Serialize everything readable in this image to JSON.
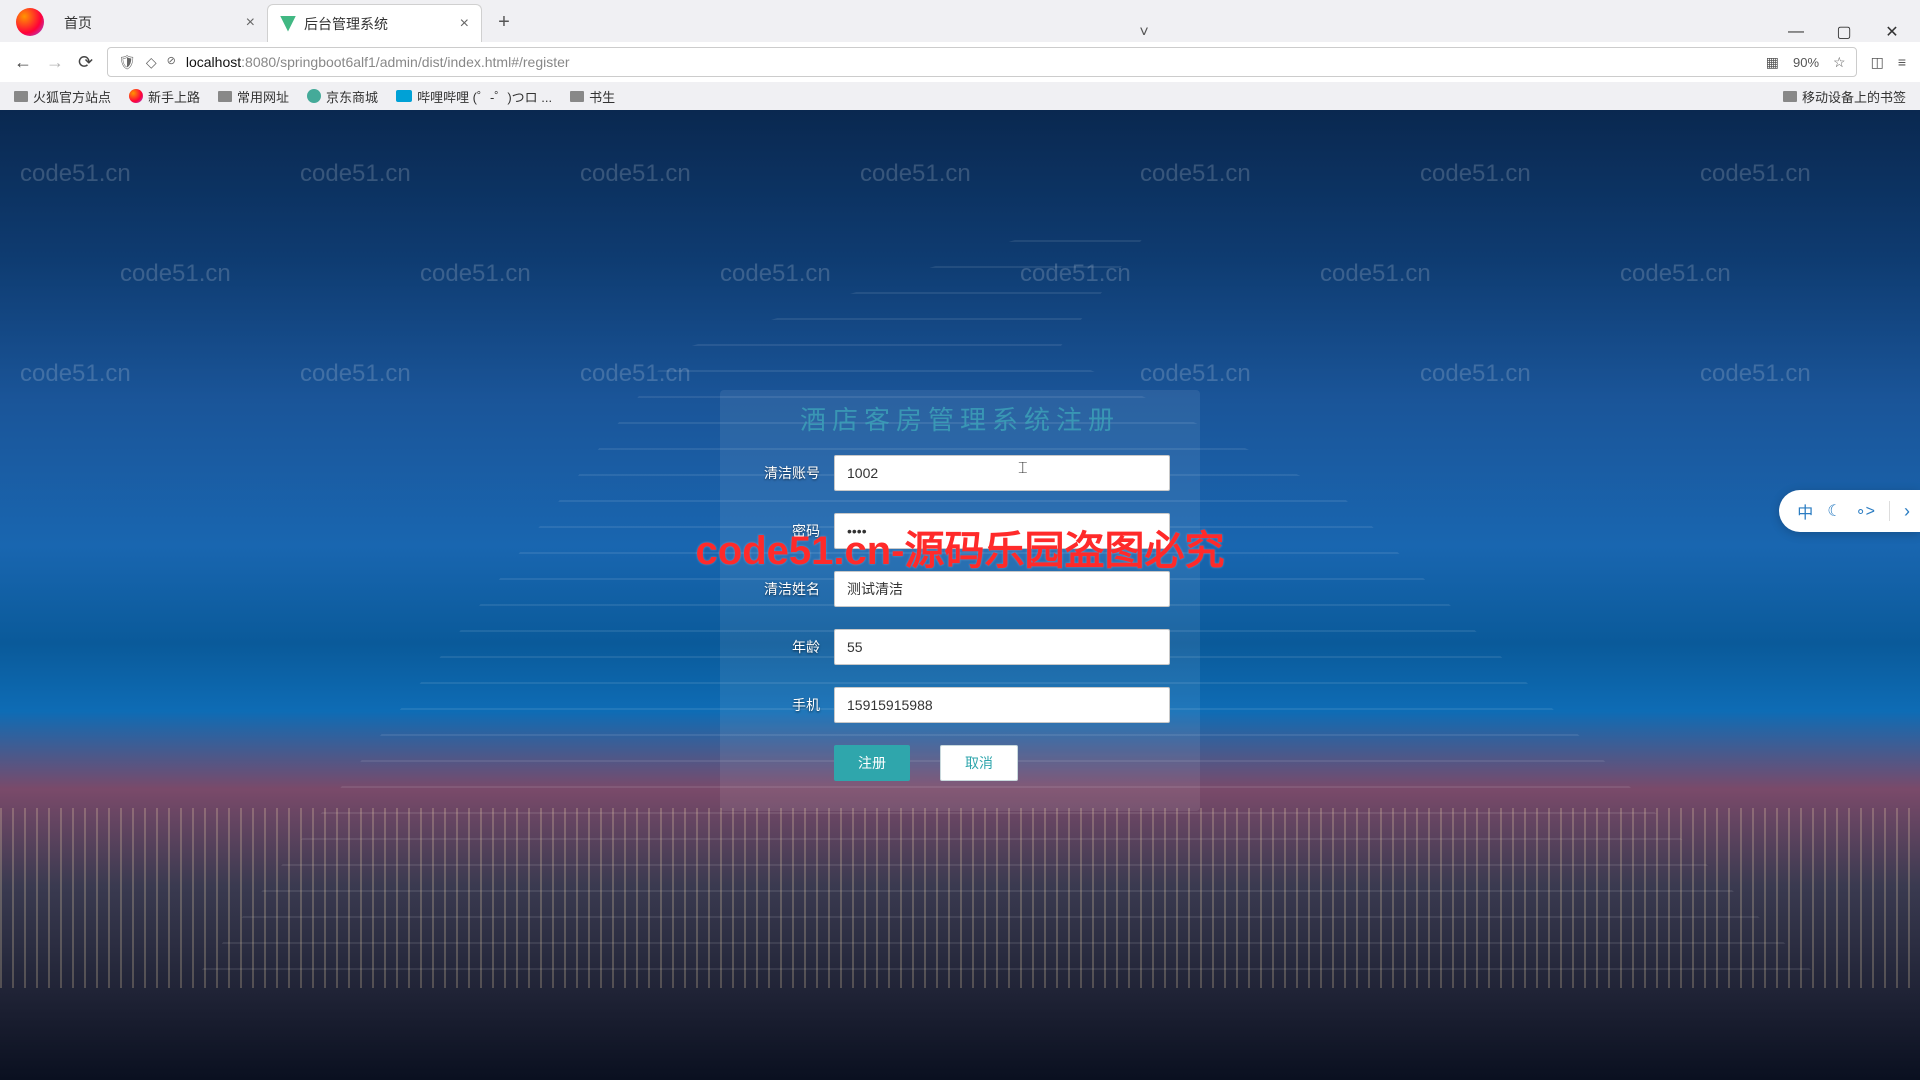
{
  "browser": {
    "tabs": [
      {
        "title": "首页"
      },
      {
        "title": "后台管理系统"
      }
    ],
    "url_host": "localhost",
    "url_path": ":8080/springboot6alf1/admin/dist/index.html#/register",
    "zoom": "90%",
    "bookmarks": [
      {
        "label": "火狐官方站点"
      },
      {
        "label": "新手上路"
      },
      {
        "label": "常用网址"
      },
      {
        "label": "京东商城"
      },
      {
        "label": "哔哩哔哩 (゜-゜)つロ ..."
      },
      {
        "label": "书生"
      }
    ],
    "mobile_bookmarks": "移动设备上的书签"
  },
  "form": {
    "title": "酒店客房管理系统注册",
    "fields": {
      "account": {
        "label": "清洁账号",
        "value": "1002"
      },
      "password": {
        "label": "密码",
        "value": "••••"
      },
      "name": {
        "label": "清洁姓名",
        "value": "测试清洁"
      },
      "age": {
        "label": "年龄",
        "value": "55"
      },
      "phone": {
        "label": "手机",
        "value": "15915915988"
      }
    },
    "register_btn": "注册",
    "cancel_btn": "取消"
  },
  "watermark": {
    "sample": "code51.cn",
    "red": "code51.cn-源码乐园盗图必究"
  },
  "float_pill": {
    "ime": "中"
  }
}
